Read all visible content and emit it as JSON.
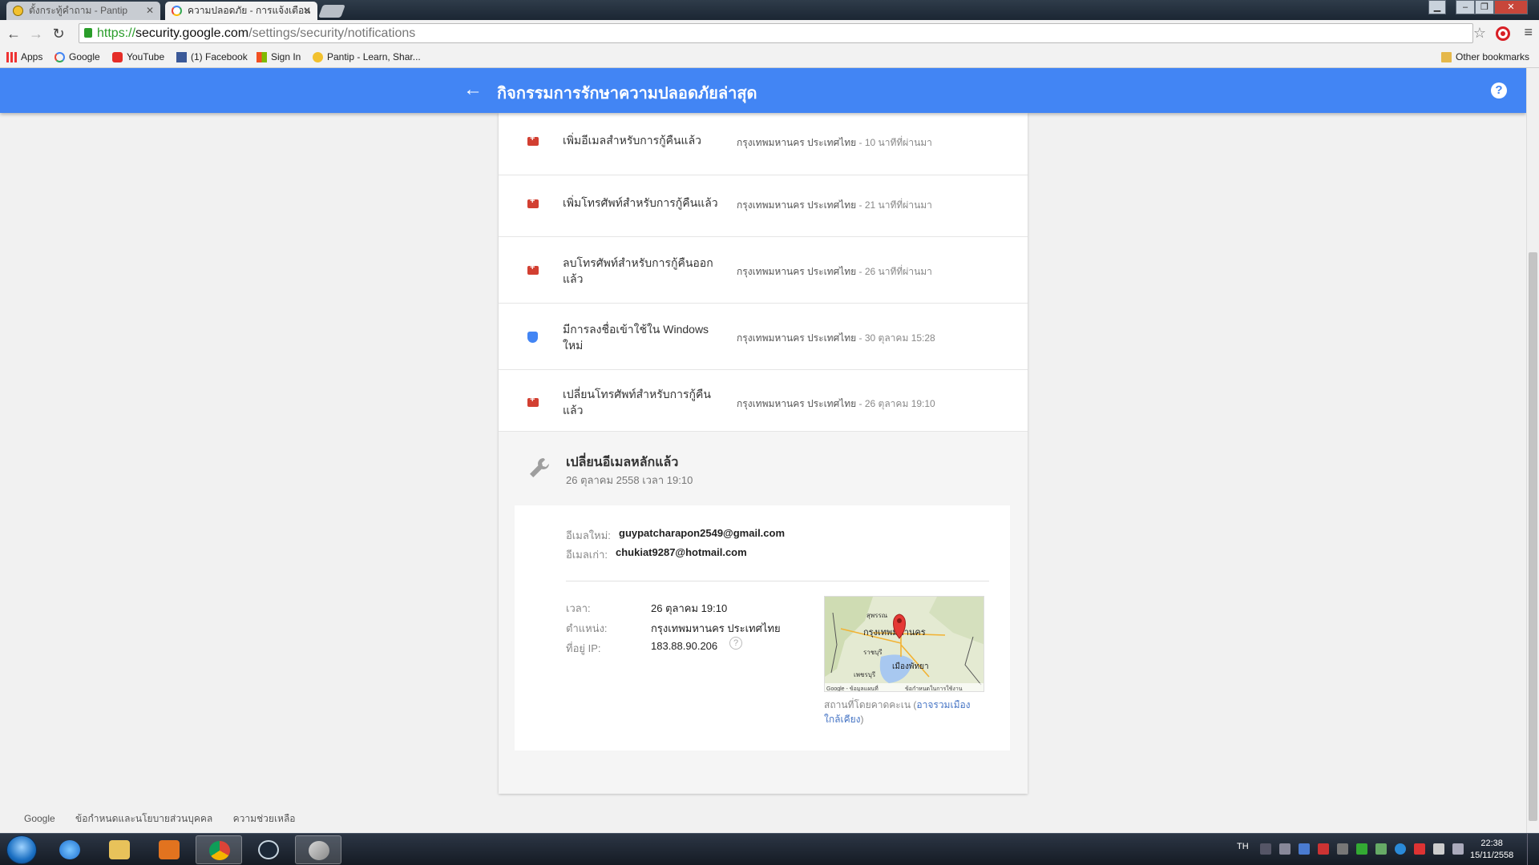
{
  "tabs": [
    {
      "title": "ตั้งกระทู้คำถาม - Pantip",
      "icon": "pantip-favicon"
    },
    {
      "title": "ความปลอดภัย - การแจ้งเตือน",
      "icon": "google-favicon"
    }
  ],
  "address": {
    "scheme": "https://",
    "host": "security.google.com",
    "path": "/settings/security/notifications"
  },
  "bookmarks": {
    "apps": "Apps",
    "google": "Google",
    "youtube": "YouTube",
    "facebook": "(1) Facebook",
    "signin": "Sign In",
    "pantip": "Pantip - Learn, Shar...",
    "other": "Other bookmarks"
  },
  "header": {
    "title": "กิจกรรมการรักษาความปลอดภัยล่าสุด"
  },
  "events": [
    {
      "title": "เพิ่มอีเมลสำหรับการกู้คืนแล้ว",
      "location": "กรุงเทพมหานคร ประเทศไทย",
      "when": " - 10 นาทีที่ผ่านมา",
      "icon": "recovery-kit-icon"
    },
    {
      "title": "เพิ่มโทรศัพท์สำหรับการกู้คืนแล้ว",
      "location": "กรุงเทพมหานคร ประเทศไทย",
      "when": " - 21 นาทีที่ผ่านมา",
      "icon": "recovery-kit-icon"
    },
    {
      "title": "ลบโทรศัพท์สำหรับการกู้คืนออกแล้ว",
      "location": "กรุงเทพมหานคร ประเทศไทย",
      "when": " - 26 นาทีที่ผ่านมา",
      "icon": "recovery-kit-icon"
    },
    {
      "title": "มีการลงชื่อเข้าใช้ใน Windows ใหม่",
      "location": "กรุงเทพมหานคร ประเทศไทย",
      "when": " - 30 ตุลาคม 15:28",
      "icon": "shield-icon"
    },
    {
      "title": "เปลี่ยนโทรศัพท์สำหรับการกู้คืนแล้ว",
      "location": "กรุงเทพมหานคร ประเทศไทย",
      "when": " - 26 ตุลาคม 19:10",
      "icon": "recovery-kit-icon"
    }
  ],
  "expanded": {
    "title": "เปลี่ยนอีเมลหลักแล้ว",
    "date": "26 ตุลาคม 2558 เวลา 19:10",
    "new_email_label": "อีเมลใหม่:",
    "new_email": "guypatcharapon2549@gmail.com",
    "old_email_label": "อีเมลเก่า:",
    "old_email": "chukiat9287@hotmail.com",
    "time_label": "เวลา:",
    "time": "26 ตุลาคม 19:10",
    "location_label": "ตำแหน่ง:",
    "location": "กรุงเทพมหานคร ประเทศไทย",
    "ip_label": "ที่อยู่ IP:",
    "ip": "183.88.90.206",
    "map_note_prefix": "สถานที่โดยคาดคะเน (",
    "map_note_link": "อาจรวมเมืองใกล้เคียง",
    "map_note_suffix": ")",
    "map_labels": {
      "city": "กรุงเทพมหานคร",
      "suphan": "สุพรรณ",
      "ratchaburi": "ราชบุรี",
      "phetchaburi": "เพชรบุรี",
      "pattaya": "เมืองพัทยา",
      "attribution": "Google - ข้อมูลแผนที่",
      "terms": "ข้อกำหนดในการใช้งาน"
    }
  },
  "footer": {
    "google": "Google",
    "privacy": "ข้อกำหนดและนโยบายส่วนบุคคล",
    "help": "ความช่วยเหลือ"
  },
  "tray": {
    "lang": "TH",
    "time": "22:38",
    "date": "15/11/2558"
  },
  "colors": {
    "appbar": "#4285f4",
    "kit": "#d23f31",
    "link": "#4473c4"
  }
}
